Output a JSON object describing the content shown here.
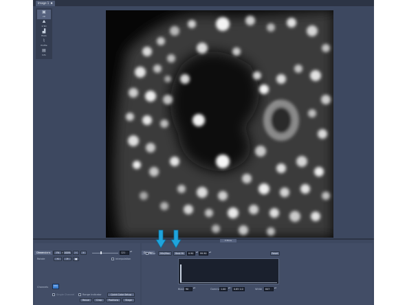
{
  "window": {
    "image_tab": "Image 1",
    "view_options": [
      {
        "label": "2D",
        "icon": "2d-view-icon",
        "active": true
      },
      {
        "label": "2.5D",
        "icon": "2-5d-view-icon",
        "active": false
      },
      {
        "label": "Histo",
        "icon": "histogram-view-icon",
        "active": false
      },
      {
        "label": "Profile",
        "icon": "profile-view-icon",
        "active": false
      },
      {
        "label": "Info",
        "icon": "info-view-icon",
        "active": false
      }
    ],
    "more_label": "▾ More"
  },
  "dimensions_panel": {
    "tabs": [
      "Dimensions",
      "Graphics"
    ],
    "zoom_label": "Zoom",
    "rotate_label": "Rotate",
    "zoom_buttons": [
      "Fit",
      "100%",
      "−",
      "+"
    ],
    "zoom_value": "121",
    "interpolation_label": "Interpolation",
    "rotate_buttons": [
      "⟲",
      "⟳",
      "■"
    ],
    "channels_label": "Channels",
    "channel_chip": "Ch1",
    "single_channel_label": "Single Channel",
    "range_indicator_label": "Range Indicator",
    "quick_color_label": "Quick Color Setup",
    "bottom_buttons": [
      "Reuse",
      "Crop",
      "Positions",
      "Stage"
    ]
  },
  "display_panel": {
    "tab": "Display",
    "auto_label": "Auto",
    "min_max_label": "Min/Max",
    "best_fit_label": "Best fit",
    "best_fit_value": "0.90",
    "percent_value": "99.90",
    "reset_label": "Reset",
    "black_label": "Black",
    "black_value": "90",
    "gamma_label": "Gamma",
    "gamma_value": "1.00",
    "gamma_values2": "0.85  1.0",
    "white_label": "White",
    "white_value": "847"
  },
  "colors": {
    "app_background": "#3d4860",
    "panel": "#424d66",
    "annotation_arrow": "#1fa4dd",
    "channel_chip": "#3c7fd1"
  }
}
